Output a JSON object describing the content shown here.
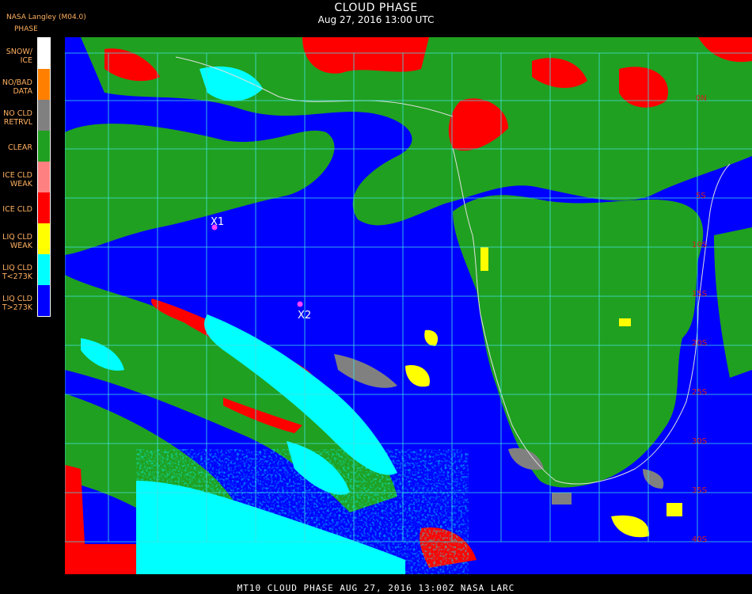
{
  "header": {
    "title": "CLOUD PHASE",
    "subtitle": "Aug 27, 2016 13:00 UTC",
    "provider": "NASA Langley (M04.0)"
  },
  "legend": {
    "title": "PHASE",
    "items": [
      {
        "label": "SNOW/\nICE",
        "color": "#ffffff"
      },
      {
        "label": "NO/BAD\nDATA",
        "color": "#ff8000"
      },
      {
        "label": "NO CLD\nRETRVL",
        "color": "#808080"
      },
      {
        "label": "CLEAR",
        "color": "#20a020"
      },
      {
        "label": "ICE CLD\nWEAK",
        "color": "#ff8080"
      },
      {
        "label": "ICE CLD",
        "color": "#ff0000"
      },
      {
        "label": "LIQ CLD\nWEAK",
        "color": "#ffff00"
      },
      {
        "label": "LIQ CLD\nT<273K",
        "color": "#00ffff"
      },
      {
        "label": "LIQ CLD\nT>273K",
        "color": "#0000ff"
      }
    ]
  },
  "markers": [
    {
      "label": "X1"
    },
    {
      "label": "X2"
    }
  ],
  "lat_labels": [
    "0N",
    "5S",
    "10S",
    "15S",
    "20S",
    "25S",
    "30S",
    "35S",
    "40S"
  ],
  "colors": {
    "grid": "#40e0e0",
    "marker": "#ff40ff",
    "coast": "#e0e0e0"
  },
  "footer": "MT10  CLOUD PHASE   AUG 27, 2016 13:00Z   NASA LARC"
}
